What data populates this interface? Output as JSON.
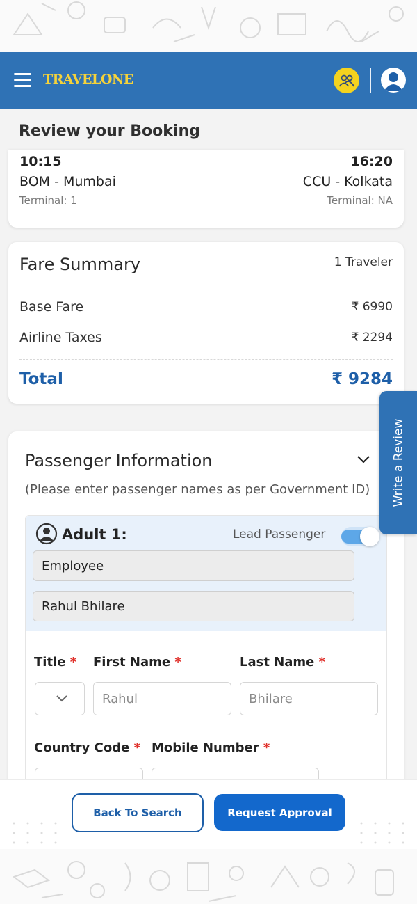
{
  "header": {
    "logo_text": "TRAVELONE",
    "menu_icon": "hamburger-menu-icon",
    "group_icon": "group-users-icon",
    "profile_icon": "user-profile-icon",
    "brand_color": "#2f72b5",
    "logo_color": "#f4d23b"
  },
  "page": {
    "title": "Review your Booking"
  },
  "flight": {
    "departure_time": "10:15",
    "arrival_time": "16:20",
    "from": "BOM - Mumbai",
    "to": "CCU - Kolkata",
    "from_terminal": "Terminal: 1",
    "to_terminal": "Terminal: NA"
  },
  "fare": {
    "title": "Fare Summary",
    "travelers": "1 Traveler",
    "rows": [
      {
        "label": "Base Fare",
        "value": "₹ 6990"
      },
      {
        "label": "Airline Taxes",
        "value": "₹ 2294"
      }
    ],
    "total_label": "Total",
    "total_value": "₹ 9284",
    "accent_color": "#1e5fa8"
  },
  "passenger": {
    "title": "Passenger Information",
    "note": "(Please enter passenger names as per Government ID)",
    "adult_label": "Adult 1:",
    "lead_label": "Lead Passenger",
    "lead_toggle_on": true,
    "type_value": "Employee",
    "name_value": "Rahul Bhilare",
    "labels": {
      "title": "Title",
      "first_name": "First Name",
      "last_name": "Last Name",
      "country_code": "Country Code",
      "mobile_number": "Mobile Number",
      "required_mark": "*"
    },
    "first_name_placeholder": "Rahul",
    "last_name_placeholder": "Bhilare"
  },
  "review_tab": {
    "label": "Write a Review"
  },
  "actions": {
    "back_label": "Back To Search",
    "request_label": "Request Approval"
  }
}
